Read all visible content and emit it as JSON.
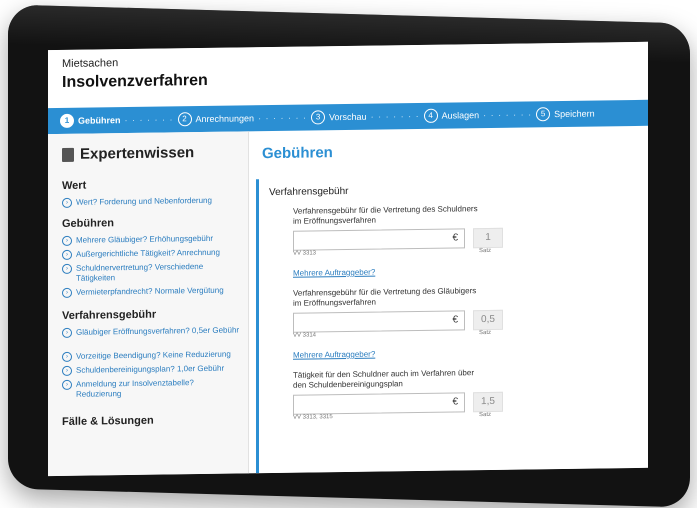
{
  "header": {
    "section": "Mietsachen",
    "title": "Insolvenzverfahren"
  },
  "steps": [
    {
      "num": "1",
      "label": "Gebühren",
      "active": true
    },
    {
      "num": "2",
      "label": "Anrechnungen",
      "active": false
    },
    {
      "num": "3",
      "label": "Vorschau",
      "active": false
    },
    {
      "num": "4",
      "label": "Auslagen",
      "active": false
    },
    {
      "num": "5",
      "label": "Speichern",
      "active": false
    }
  ],
  "sidebar": {
    "title": "Expertenwissen",
    "wert_heading": "Wert",
    "wert_link": "Wert? Forderung und Nebenforderung",
    "gebuehren_heading": "Gebühren",
    "gebuehren_links": [
      "Mehrere Gläubiger? Erhöhungsgebühr",
      "Außergerichtliche Tätigkeit? Anrechnung",
      "Schuldnervertretung? Verschiedene Tätigkeiten",
      "Vermieterpfandrecht? Normale Vergütung"
    ],
    "verfahren_heading": "Verfahrensgebühr",
    "verfahren_links": [
      "Gläubiger Eröffnungsverfahren? 0,5er Gebühr",
      "Vorzeitige Beendigung? Keine Reduzierung",
      "Schuldenbereinigungsplan? 1,0er Gebühr",
      "Anmeldung zur Insolvenztabelle? Reduzierung"
    ],
    "faelle_heading": "Fälle & Lösungen"
  },
  "main": {
    "title": "Gebühren",
    "panel_title": "Verfahrensgebühr",
    "fields": [
      {
        "label": "Verfahrensgebühr für die Vertretung des Schuldners im Eröffnungsverfahren",
        "currency": "€",
        "satz": "1",
        "vv": "VV 3313",
        "satz_label": "Satz"
      },
      {
        "label": "Verfahrensgebühr für die Vertretung des Gläubigers im Eröffnungsverfahren",
        "currency": "€",
        "satz": "0,5",
        "vv": "VV 3314",
        "satz_label": "Satz"
      },
      {
        "label": "Tätigkeit für den Schuldner auch im Verfahren über den Schuldenbereinigungsplan",
        "currency": "€",
        "satz": "1,5",
        "vv": "VV 3313, 3315",
        "satz_label": "Satz"
      }
    ],
    "mehrere_link": "Mehrere Auftraggeber?"
  },
  "colors": {
    "accent": "#2b8fd3",
    "link": "#2b7dbf"
  }
}
